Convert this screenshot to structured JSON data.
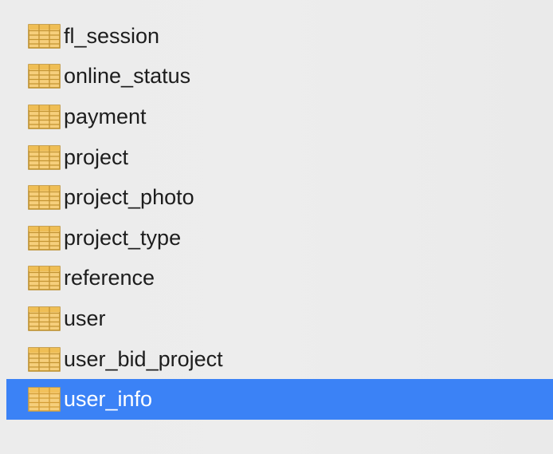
{
  "sidebar": {
    "items": [
      {
        "label": "fl_session",
        "icon": "table-icon",
        "selected": false
      },
      {
        "label": "online_status",
        "icon": "table-icon",
        "selected": false
      },
      {
        "label": "payment",
        "icon": "table-icon",
        "selected": false
      },
      {
        "label": "project",
        "icon": "table-icon",
        "selected": false
      },
      {
        "label": "project_photo",
        "icon": "table-icon",
        "selected": false
      },
      {
        "label": "project_type",
        "icon": "table-icon",
        "selected": false
      },
      {
        "label": "reference",
        "icon": "table-icon",
        "selected": false
      },
      {
        "label": "user",
        "icon": "table-icon",
        "selected": false
      },
      {
        "label": "user_bid_project",
        "icon": "table-icon",
        "selected": false
      },
      {
        "label": "user_info",
        "icon": "table-icon",
        "selected": true
      }
    ]
  },
  "colors": {
    "background": "#ececec",
    "selected_row": "#3b82f6",
    "selected_text": "#ffffff",
    "text": "#1d1d1d",
    "table_icon_fill": "#f3c76f",
    "table_icon_line": "#b98a25"
  }
}
